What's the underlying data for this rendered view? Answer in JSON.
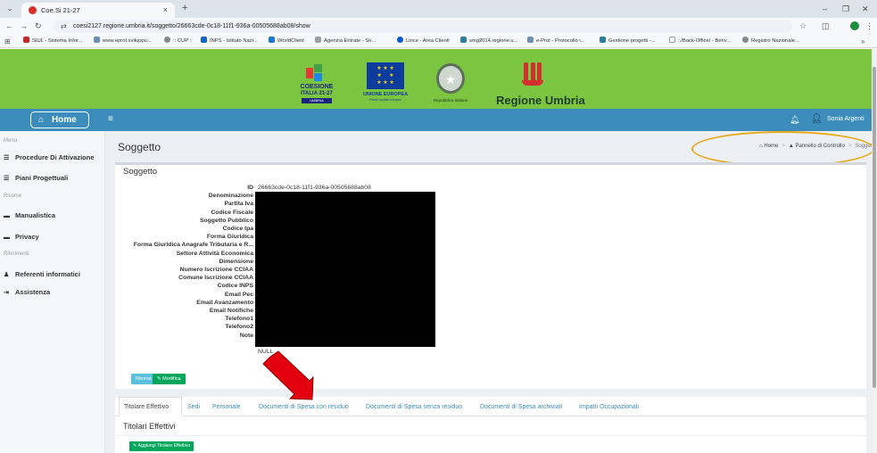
{
  "browser": {
    "tab_title": "Coe.Si 21-27",
    "tab_close": "×",
    "new_tab": "+",
    "url": "coesi2127.regione.umbria.it/soggetto/26663cde-0c18-11f1-936a-00505688ab08/show",
    "bookmarks": [
      "SIUL - Sistema Infor...",
      "www.eprot.sviluppu...",
      ":: CUP ::",
      "INPS - Istituto Nazi...",
      "WorldClient",
      "Agenzia Entrate - Se...",
      "Lince - Area Clienti",
      "smg2014.regione.u...",
      "e-Prot - Protocollo i...",
      "Gestione progetti -...",
      "../Back-Office/ - Benv...",
      "Registro Nazionale..."
    ],
    "bookmark_more": "»"
  },
  "header": {
    "coesione_t1": "COESIONE",
    "coesione_t2": "ITALIA 21-27",
    "coesione_t3": "UMBRIA",
    "eu_t1": "UNIONE EUROPEA",
    "eu_t2": "Fondo sociale europeo",
    "rep_t": "Repubblica Italiana",
    "region_name": "Regione Umbria"
  },
  "navbar": {
    "home_label": "Home",
    "user_name": "Sonia Argenti"
  },
  "sidebar": {
    "headers": [
      "Menù",
      "Risorse",
      "Riferimenti"
    ],
    "items": [
      {
        "label": "Procedure Di Attivazione"
      },
      {
        "label": "Piani Progettuali"
      },
      {
        "label": "Manualistica"
      },
      {
        "label": "Privacy"
      },
      {
        "label": "Referenti informatici"
      },
      {
        "label": "Assistenza"
      }
    ]
  },
  "page": {
    "title": "Soggetto",
    "breadcrumb": [
      "Home",
      "Pannello di Controllo",
      "Soggetto"
    ],
    "box_title": "Soggetto",
    "id_value": "26663cde-0c18-11f1-936a-00505688ab08",
    "note_value": "NULL",
    "fields": [
      "ID",
      "Denominazione",
      "Partita Iva",
      "Codice Fiscale",
      "Soggetto Pubblico",
      "Codice Ipa",
      "Forma Giuridica",
      "Forma Giuridica Anagrafe Tributaria e R...",
      "Settore Attività Economica",
      "Dimensione",
      "Numero Iscrizione CCIAA",
      "Comune Iscrizione CCIAA",
      "Codice INPS",
      "Email Pec",
      "Email Avanzamento",
      "Email Notifiche",
      "Telefono1",
      "Telefono2",
      "Note"
    ],
    "btn_ritorna": "Ritorna",
    "btn_modifica": "Modifica"
  },
  "tabs": [
    "Titolare Effettivo",
    "Sedi",
    "Personale",
    "Documenti di Spesa con residuo",
    "Documenti di Spesa senza residuo",
    "Documenti di Spesa archiviati",
    "Impatti Occupazionali"
  ],
  "titolari": {
    "title": "Titolari Effettivi",
    "add_button": "Aggiungi Titolare Effettivo"
  },
  "colors": {
    "header_green": "#7cc540",
    "navbar_blue": "#3c8dbc",
    "annotation_oval": "#e6a817",
    "annotation_arrow": "#e3000f"
  }
}
